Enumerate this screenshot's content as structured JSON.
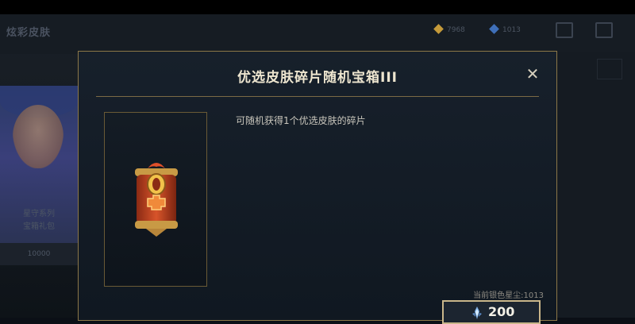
{
  "background": {
    "header_title": "炫彩皮肤",
    "currencies": [
      {
        "icon": "gold-gem-icon",
        "value": "7968",
        "color": "#c59a3a"
      },
      {
        "icon": "blue-gem-icon",
        "value": "1013",
        "color": "#3f6fb8"
      }
    ],
    "card": {
      "name_line1": "星守系列",
      "name_line2": "宝箱礼包",
      "price": "10000"
    }
  },
  "modal": {
    "title": "优选皮肤碎片随机宝箱III",
    "close_label": "✕",
    "description": "可随机获得1个优选皮肤的碎片",
    "item_icon": "treasure-chest-icon",
    "current_dust_label": "当前银色星尘:",
    "current_dust_value": "1013",
    "price_icon": "silver-stardust-icon",
    "price": "200"
  },
  "colors": {
    "accent_gold": "#8c7748",
    "title_text": "#ede5cf",
    "price_border": "#c9b68a"
  }
}
